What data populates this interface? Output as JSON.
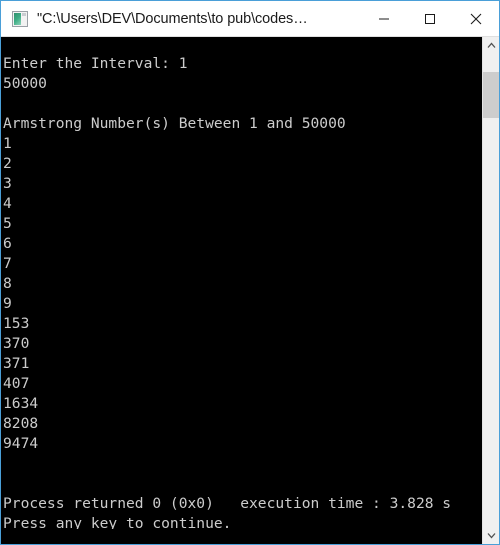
{
  "window": {
    "title": "\"C:\\Users\\DEV\\Documents\\to pub\\codes…",
    "icon": "console-app-icon",
    "border_color": "#4a9fd8",
    "titlebar_bg": "#ffffff",
    "titlebar_fg": "#1b1b1b"
  },
  "titlebar_buttons": {
    "minimize": "minimize-icon",
    "maximize": "maximize-icon",
    "close": "close-icon"
  },
  "console": {
    "background": "#000000",
    "foreground": "#cccccc",
    "lines": [
      "Enter the Interval: 1",
      "50000",
      "",
      "Armstrong Number(s) Between 1 and 50000",
      "1",
      "2",
      "3",
      "4",
      "5",
      "6",
      "7",
      "8",
      "9",
      "153",
      "370",
      "371",
      "407",
      "1634",
      "8208",
      "9474",
      "",
      "",
      "Process returned 0 (0x0)   execution time : 3.828 s",
      "Press any key to continue."
    ],
    "prompt": "Enter the Interval:",
    "interval_start": "1",
    "interval_end": "50000",
    "results_header": "Armstrong Number(s) Between 1 and 50000",
    "armstrong_numbers": [
      "1",
      "2",
      "3",
      "4",
      "5",
      "6",
      "7",
      "8",
      "9",
      "153",
      "370",
      "371",
      "407",
      "1634",
      "8208",
      "9474"
    ],
    "exit_status": "Process returned 0 (0x0)",
    "execution_time": "execution time : 3.828 s",
    "continue_prompt": "Press any key to continue."
  },
  "scrollbar": {
    "up_arrow": "chevron-up-icon",
    "down_arrow": "chevron-down-icon",
    "track_color": "#f0f0f0",
    "thumb_color": "#cdcdcd"
  }
}
